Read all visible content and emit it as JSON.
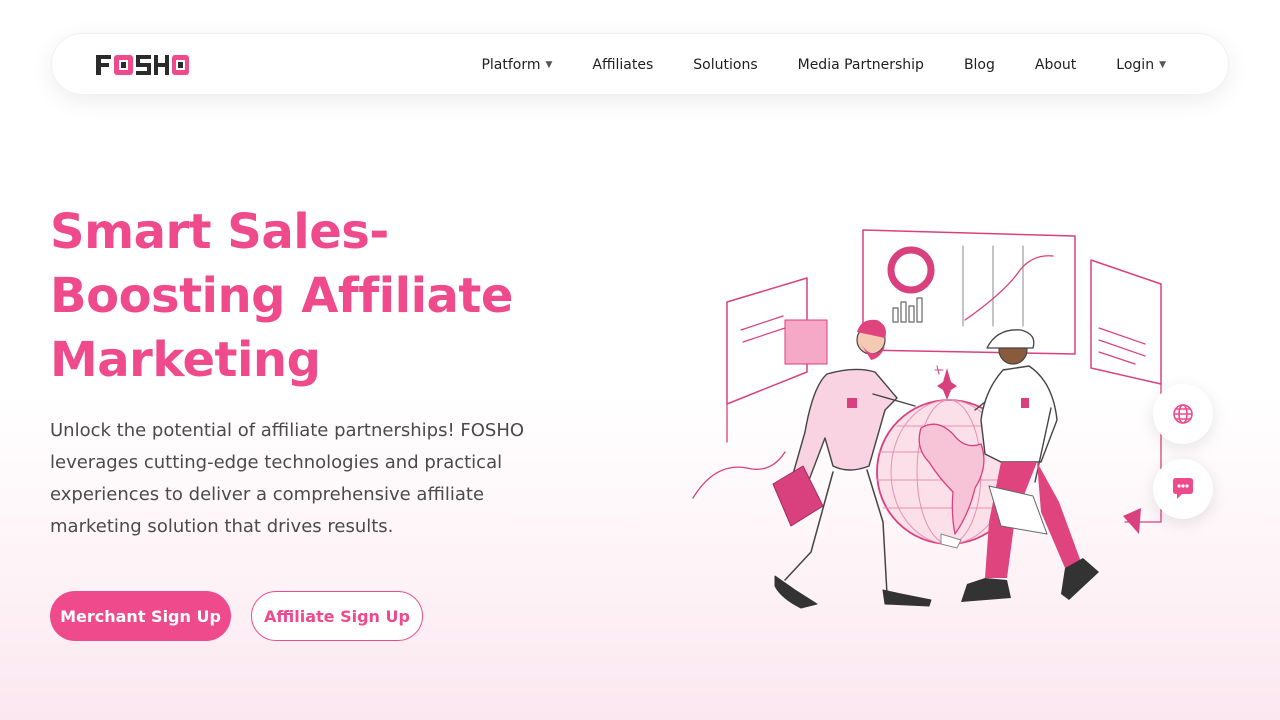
{
  "brand": {
    "name": "FOSHO",
    "accent": "#ee4a8c",
    "dark": "#2b2b2b"
  },
  "nav": {
    "items": [
      {
        "label": "Platform",
        "dropdown": true
      },
      {
        "label": "Affiliates",
        "dropdown": false
      },
      {
        "label": "Solutions",
        "dropdown": false
      },
      {
        "label": "Media Partnership",
        "dropdown": false
      },
      {
        "label": "Blog",
        "dropdown": false
      },
      {
        "label": "About",
        "dropdown": false
      },
      {
        "label": "Login",
        "dropdown": true
      }
    ],
    "caret": "▼"
  },
  "hero": {
    "title": "Smart Sales-Boosting Affiliate Marketing",
    "description": "Unlock the potential of affiliate partnerships! FOSHO leverages cutting-edge technologies and practical experiences to deliver a comprehensive affiliate marketing solution that drives results.",
    "primary_button": "Merchant Sign Up",
    "secondary_button": "Affiliate Sign Up"
  },
  "floating": {
    "icons": [
      "globe-icon",
      "chat-icon"
    ]
  }
}
